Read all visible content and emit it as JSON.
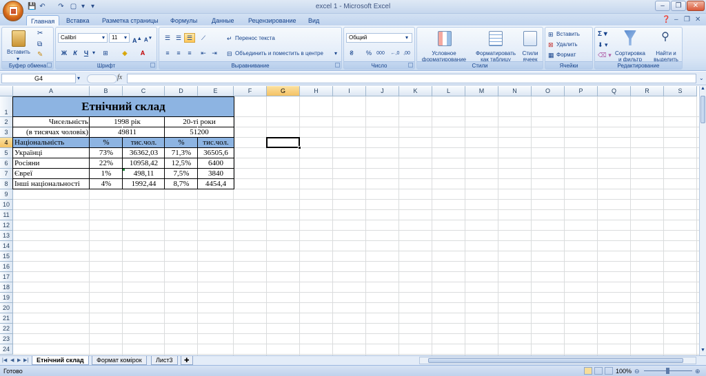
{
  "window": {
    "title": "excel 1 - Microsoft Excel"
  },
  "tabs": [
    "Главная",
    "Вставка",
    "Разметка страницы",
    "Формулы",
    "Данные",
    "Рецензирование",
    "Вид"
  ],
  "ribbon": {
    "clipboard": {
      "paste": "Вставить",
      "group": "Буфер обмена"
    },
    "font": {
      "name": "Calibri",
      "size": "11",
      "bold": "Ж",
      "italic": "К",
      "underline": "Ч",
      "group": "Шрифт"
    },
    "alignment": {
      "wrap": "Перенос текста",
      "merge": "Объединить и поместить в центре",
      "group": "Выравнивание"
    },
    "number": {
      "format": "Общий",
      "percent": "%",
      "thousands": "000",
      "group": "Число"
    },
    "styles": {
      "conditional": "Условное форматирование",
      "as_table": "Форматировать как таблицу",
      "cell_styles": "Стили ячеек",
      "group": "Стили"
    },
    "cells": {
      "insert": "Вставить",
      "delete": "Удалить",
      "format": "Формат",
      "group": "Ячейки"
    },
    "editing": {
      "sort": "Сортировка и фильтр",
      "find": "Найти и выделить",
      "group": "Редактирование"
    }
  },
  "formula_bar": {
    "name_box": "G4",
    "fx": "fx",
    "formula": ""
  },
  "columns": [
    "A",
    "B",
    "C",
    "D",
    "E",
    "F",
    "G",
    "H",
    "I",
    "J",
    "K",
    "L",
    "M",
    "N",
    "O",
    "P",
    "Q",
    "R",
    "S"
  ],
  "rows": [
    "1",
    "2",
    "3",
    "4",
    "5",
    "6",
    "7",
    "8",
    "9",
    "10",
    "11",
    "12",
    "13",
    "14",
    "15",
    "16",
    "17",
    "18",
    "19",
    "20",
    "21",
    "22",
    "23",
    "24"
  ],
  "sheet": {
    "title": "Етнічний склад",
    "r2": {
      "a": "Чисельність",
      "bc": "1998 рік",
      "de": "20-ті роки"
    },
    "r3": {
      "a": "(в тисячах чоловік)",
      "bc": "49811",
      "de": "51200"
    },
    "r4": {
      "a": "Національність",
      "b": "%",
      "c": "тис.чол.",
      "d": "%",
      "e": "тис.чол."
    },
    "data": [
      {
        "a": "Українці",
        "b": "73%",
        "c": "36362,03",
        "d": "71,3%",
        "e": "36505,6"
      },
      {
        "a": "Росіяни",
        "b": "22%",
        "c": "10958,42",
        "d": "12,5%",
        "e": "6400"
      },
      {
        "a": "Євреї",
        "b": "1%",
        "c": "498,11",
        "d": "7,5%",
        "e": "3840"
      },
      {
        "a": "Інші національності",
        "b": "4%",
        "c": "1992,44",
        "d": "8,7%",
        "e": "4454,4"
      }
    ]
  },
  "sheet_tabs": [
    "Етнічний склад",
    "Формат комірок",
    "Лист3"
  ],
  "status": {
    "ready": "Готово",
    "zoom": "100%"
  },
  "colors": {
    "header_fill": "#8db4e2",
    "selection": "#000000"
  }
}
